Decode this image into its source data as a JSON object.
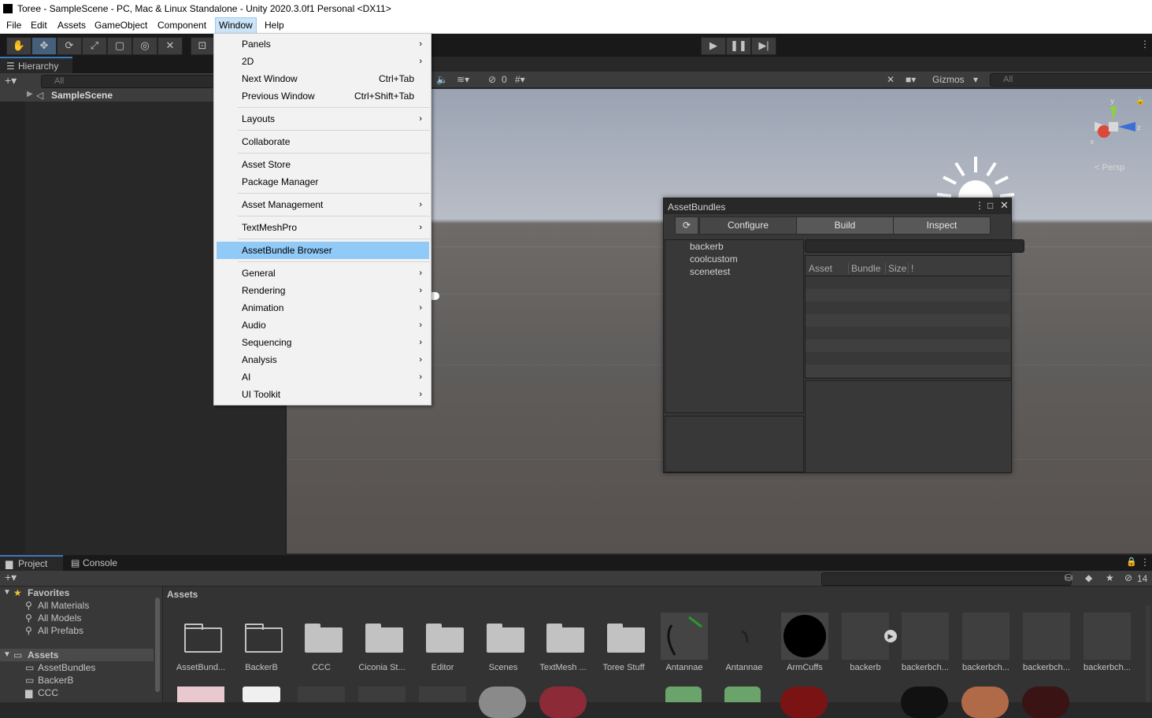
{
  "window": {
    "title": "Toree - SampleScene - PC, Mac & Linux Standalone - Unity 2020.3.0f1 Personal <DX11>"
  },
  "menubar": [
    "File",
    "Edit",
    "Assets",
    "GameObject",
    "Component",
    "Window",
    "Help"
  ],
  "window_menu": {
    "items": [
      {
        "label": "Panels",
        "shortcut": "",
        "submenu": true
      },
      {
        "label": "2D",
        "shortcut": "",
        "submenu": true
      },
      {
        "label": "Next Window",
        "shortcut": "Ctrl+Tab",
        "submenu": false
      },
      {
        "label": "Previous Window",
        "shortcut": "Ctrl+Shift+Tab",
        "submenu": false
      },
      {
        "label": "Layouts",
        "shortcut": "",
        "submenu": true
      },
      {
        "label": "Collaborate",
        "shortcut": "",
        "submenu": false
      },
      {
        "label": "Asset Store",
        "shortcut": "",
        "submenu": false
      },
      {
        "label": "Package Manager",
        "shortcut": "",
        "submenu": false
      },
      {
        "label": "Asset Management",
        "shortcut": "",
        "submenu": true
      },
      {
        "label": "TextMeshPro",
        "shortcut": "",
        "submenu": true
      },
      {
        "label": "AssetBundle Browser",
        "shortcut": "",
        "submenu": false,
        "highlighted": true
      },
      {
        "label": "General",
        "shortcut": "",
        "submenu": true
      },
      {
        "label": "Rendering",
        "shortcut": "",
        "submenu": true
      },
      {
        "label": "Animation",
        "shortcut": "",
        "submenu": true
      },
      {
        "label": "Audio",
        "shortcut": "",
        "submenu": true
      },
      {
        "label": "Sequencing",
        "shortcut": "",
        "submenu": true
      },
      {
        "label": "Analysis",
        "shortcut": "",
        "submenu": true
      },
      {
        "label": "AI",
        "shortcut": "",
        "submenu": true
      },
      {
        "label": "UI Toolkit",
        "shortcut": "",
        "submenu": true
      }
    ]
  },
  "hierarchy": {
    "tab": "Hierarchy",
    "search_placeholder": "All",
    "scene": "SampleScene"
  },
  "scene_view": {
    "gizmos": "Gizmos",
    "search_placeholder": "All",
    "hidden_count": "0",
    "persp": "< Persp"
  },
  "assetbundles": {
    "title": "AssetBundles",
    "tabs": [
      "Configure",
      "Build",
      "Inspect"
    ],
    "bundles": [
      "backerb",
      "coolcustom",
      "scenetest"
    ],
    "columns": [
      "Asset",
      "Bundle",
      "Size",
      "!"
    ]
  },
  "project": {
    "tabs": [
      "Project",
      "Console"
    ],
    "hidden_count": "14",
    "breadcrumb": "Assets",
    "favorites_label": "Favorites",
    "favorites": [
      "All Materials",
      "All Models",
      "All Prefabs"
    ],
    "assets_label": "Assets",
    "folders": [
      "AssetBundles",
      "BackerB",
      "CCC"
    ],
    "assets": [
      {
        "name": "AssetBund...",
        "kind": "folder-outline"
      },
      {
        "name": "BackerB",
        "kind": "folder-outline"
      },
      {
        "name": "CCC",
        "kind": "folder"
      },
      {
        "name": "Ciconia St...",
        "kind": "folder"
      },
      {
        "name": "Editor",
        "kind": "folder"
      },
      {
        "name": "Scenes",
        "kind": "folder"
      },
      {
        "name": "TextMesh ...",
        "kind": "folder"
      },
      {
        "name": "Toree Stuff",
        "kind": "folder"
      },
      {
        "name": "Antannae",
        "kind": "model"
      },
      {
        "name": "Antannae",
        "kind": "mesh"
      },
      {
        "name": "ArmCuffs",
        "kind": "black-sphere"
      },
      {
        "name": "backerb",
        "kind": "prefab-play"
      },
      {
        "name": "backerbch...",
        "kind": "blank"
      },
      {
        "name": "backerbch...",
        "kind": "blank"
      },
      {
        "name": "backerbch...",
        "kind": "blank"
      },
      {
        "name": "backerbch...",
        "kind": "blank"
      }
    ]
  },
  "colors": {
    "highlight": "#91c9f7",
    "accent": "#3a79bb",
    "panel": "#383838"
  }
}
